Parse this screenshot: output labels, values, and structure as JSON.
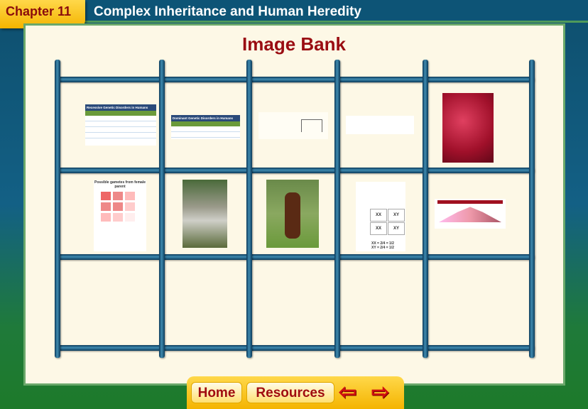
{
  "header": {
    "chapter": "Chapter 11",
    "title": "Complex Inheritance and Human Heredity"
  },
  "page_title": "Image Bank",
  "thumbnails": {
    "t1": "Recessive Genetic Disorders in Humans",
    "t2": "Dominant Genetic Disorders in Humans",
    "t6": "Possible gametes from female parent",
    "t9a": "XX = 2/4 = 1/2",
    "t9b": "XY = 2/4 = 1/2",
    "t9cells": [
      "XX",
      "XY",
      "XX",
      "XY"
    ]
  },
  "nav": {
    "home": "Home",
    "resources": "Resources",
    "back_icon": "arrow-left-icon",
    "forward_icon": "arrow-right-icon"
  },
  "colors": {
    "title": "#9a0d12",
    "tab": "#f4b400",
    "frame": "#0d5476"
  }
}
